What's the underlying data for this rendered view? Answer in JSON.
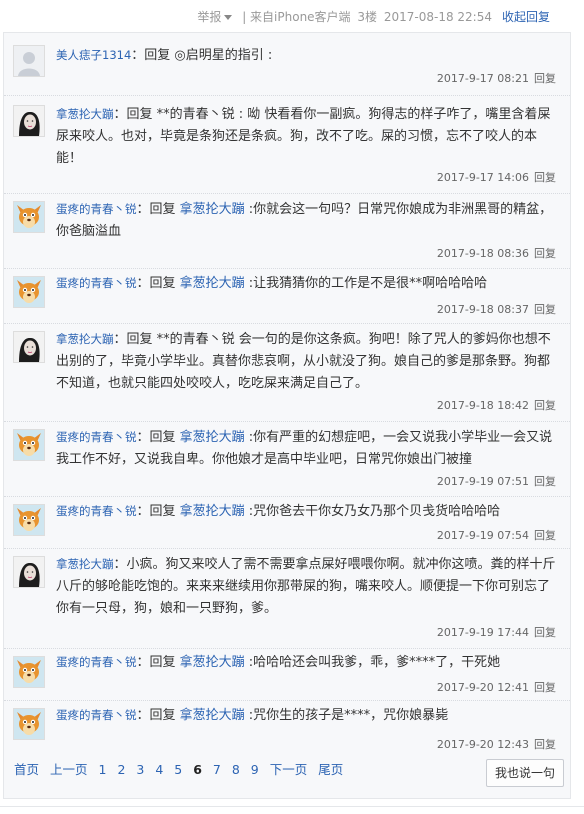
{
  "post_meta": {
    "report": "举报",
    "source": "| 来自iPhone客户端",
    "floor": "3楼",
    "datetime": "2017-08-18 22:54",
    "collapse": "收起回复"
  },
  "replies": [
    {
      "user": "美人痣子1314",
      "text": "：回复 ◎启明星的指引 :",
      "target": "",
      "after": "",
      "time": "2017-9-17 08:21",
      "reply_label": "回复",
      "avatar": "default-avatar-icon"
    },
    {
      "user": "拿葱抡大蹦",
      "text": "：回复 **的青春丶锐 : 呦 快看看你一副疯。狗得志的样子咋了，嘴里含着屎尿来咬人。也对，毕竟是条狗还是条疯。狗，改不了吃。屎的习惯，忘不了咬人的本能！",
      "target": "",
      "after": "",
      "time": "2017-9-17 14:06",
      "reply_label": "回复",
      "avatar": "girl-photo-avatar"
    },
    {
      "user": "蛋疼的青春丶锐",
      "text": "：回复 ",
      "target": "拿葱抡大蹦",
      "after": " :你就会这一句吗？日常咒你娘成为非洲黑哥的精盆，你爸脑溢血",
      "time": "2017-9-18 08:36",
      "reply_label": "回复",
      "avatar": "fox-cartoon-avatar"
    },
    {
      "user": "蛋疼的青春丶锐",
      "text": "：回复 ",
      "target": "拿葱抡大蹦",
      "after": " :让我猜猜你的工作是不是很**啊哈哈哈哈",
      "time": "2017-9-18 08:37",
      "reply_label": "回复",
      "avatar": "fox-cartoon-avatar"
    },
    {
      "user": "拿葱抡大蹦",
      "text": "：回复 **的青春丶锐 会一句的是你这条疯。狗吧！除了咒人的爹妈你也想不出别的了，毕竟小学毕业。真替你悲哀啊，从小就没了狗。娘自己的爹是那条野。狗都不知道，也就只能四处咬咬人，吃吃屎来满足自己了。",
      "target": "",
      "after": "",
      "time": "2017-9-18 18:42",
      "reply_label": "回复",
      "avatar": "girl-photo-avatar"
    },
    {
      "user": "蛋疼的青春丶锐",
      "text": "：回复 ",
      "target": "拿葱抡大蹦",
      "after": " :你有严重的幻想症吧，一会又说我小学毕业一会又说我工作不好，又说我自卑。你他娘才是高中毕业吧，日常咒你娘出门被撞",
      "time": "2017-9-19 07:51",
      "reply_label": "回复",
      "avatar": "fox-cartoon-avatar"
    },
    {
      "user": "蛋疼的青春丶锐",
      "text": "：回复 ",
      "target": "拿葱抡大蹦",
      "after": " :咒你爸去干你女乃女乃那个贝戋货哈哈哈哈",
      "time": "2017-9-19 07:54",
      "reply_label": "回复",
      "avatar": "fox-cartoon-avatar"
    },
    {
      "user": "拿葱抡大蹦",
      "text": "：小疯。狗又来咬人了需不需要拿点屎好喂喂你啊。就冲你这喷。粪的样十斤八斤的够呛能吃饱的。来来来继续用你那带屎的狗，嘴来咬人。顺便提一下你可别忘了你有一只母，狗，娘和一只野狗，爹。",
      "target": "",
      "after": "",
      "time": "2017-9-19 17:44",
      "reply_label": "回复",
      "avatar": "girl-photo-avatar"
    },
    {
      "user": "蛋疼的青春丶锐",
      "text": "：回复 ",
      "target": "拿葱抡大蹦",
      "after": " :哈哈哈还会叫我爹，乖，爹****了，干死她",
      "time": "2017-9-20 12:41",
      "reply_label": "回复",
      "avatar": "fox-cartoon-avatar"
    },
    {
      "user": "蛋疼的青春丶锐",
      "text": "：回复 ",
      "target": "拿葱抡大蹦",
      "after": " :咒你生的孩子是****，咒你娘暴毙",
      "time": "2017-9-20 12:43",
      "reply_label": "回复",
      "avatar": "fox-cartoon-avatar"
    }
  ],
  "pager": {
    "first": "首页",
    "prev": "上一页",
    "pages": [
      "1",
      "2",
      "3",
      "4",
      "5",
      "6",
      "7",
      "8",
      "9"
    ],
    "current": "6",
    "next": "下一页",
    "last": "尾页"
  },
  "say_button": "我也说一句",
  "colors": {
    "link": "#2d64b3",
    "panel_bg": "#f7f8fa",
    "border": "#e5e7ea"
  }
}
